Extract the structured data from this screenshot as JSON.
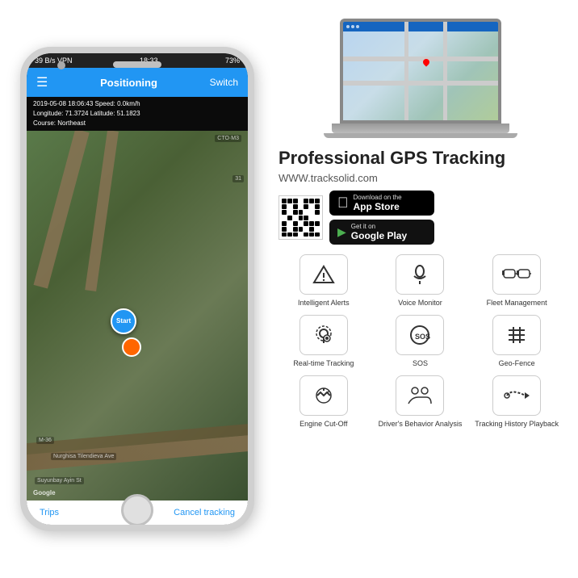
{
  "phone": {
    "status": {
      "left": "39 B/s  VPN",
      "time": "18:33",
      "right": "73%"
    },
    "nav": {
      "title": "Positioning",
      "switch": "Switch"
    },
    "gps_info": {
      "line1": "2019-05-08 18:06:43  Speed: 0.0km/h",
      "line2": "Longitude: 71.3724  Latitude: 51.1823",
      "line3": "Course: Northeast"
    },
    "bottom": {
      "trips": "Trips",
      "cancel": "Cancel tracking"
    }
  },
  "right": {
    "laptop": {},
    "title": "Professional GPS Tracking",
    "url": "WWW.tracksolid.com",
    "appstore": {
      "small": "Download on the",
      "name": "App Store"
    },
    "googleplay": {
      "small": "Get it on",
      "name": "Google Play"
    },
    "features": [
      {
        "icon": "⚠",
        "label": "Intelligent Alerts"
      },
      {
        "icon": "🎤",
        "label": "Voice Monitor"
      },
      {
        "icon": "🚗",
        "label": "Fleet Management"
      },
      {
        "icon": "📍",
        "label": "Real-time Tracking"
      },
      {
        "icon": "SOS",
        "label": "SOS"
      },
      {
        "icon": "#",
        "label": "Geo-Fence"
      },
      {
        "icon": "⚙",
        "label": "Engine Cut-Off"
      },
      {
        "icon": "👥",
        "label": "Driver's Behavior Analysis"
      },
      {
        "icon": "▶",
        "label": "Tracking History Playback"
      }
    ]
  }
}
